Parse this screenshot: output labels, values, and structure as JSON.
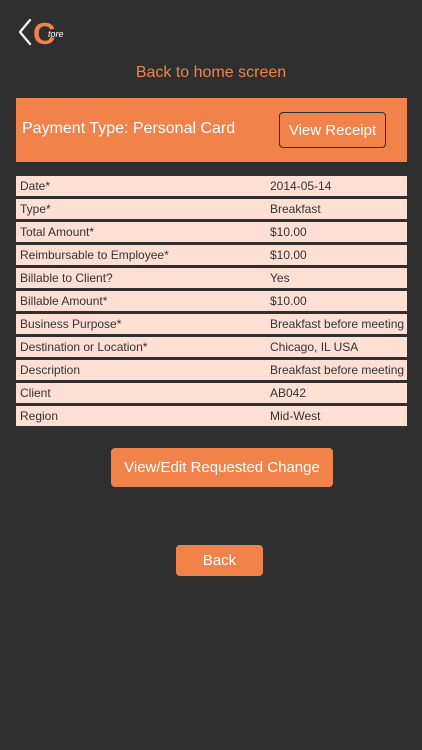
{
  "header": {
    "logo_letter": "C",
    "logo_text": "tore",
    "home_link": "Back to home screen"
  },
  "banner": {
    "title": "Payment Type: Personal Card",
    "receipt_button": "View Receipt"
  },
  "details": [
    {
      "label": "Date*",
      "value": "2014-05-14"
    },
    {
      "label": "Type*",
      "value": "Breakfast"
    },
    {
      "label": "Total Amount*",
      "value": "$10.00"
    },
    {
      "label": "Reimbursable to Employee*",
      "value": "$10.00"
    },
    {
      "label": "Billable to Client?",
      "value": "Yes"
    },
    {
      "label": "Billable Amount*",
      "value": "$10.00"
    },
    {
      "label": "Business Purpose*",
      "value": "Breakfast before meeting"
    },
    {
      "label": "Destination or Location*",
      "value": "Chicago, IL USA"
    },
    {
      "label": "Description",
      "value": "Breakfast before meeting"
    },
    {
      "label": "Client",
      "value": "AB042"
    },
    {
      "label": "Region",
      "value": "Mid-West"
    }
  ],
  "actions": {
    "change_button": "View/Edit Requested Change",
    "back_button": "Back"
  },
  "colors": {
    "background": "#2f2f2f",
    "accent": "#f0824a",
    "row_background": "#fde0d3"
  }
}
